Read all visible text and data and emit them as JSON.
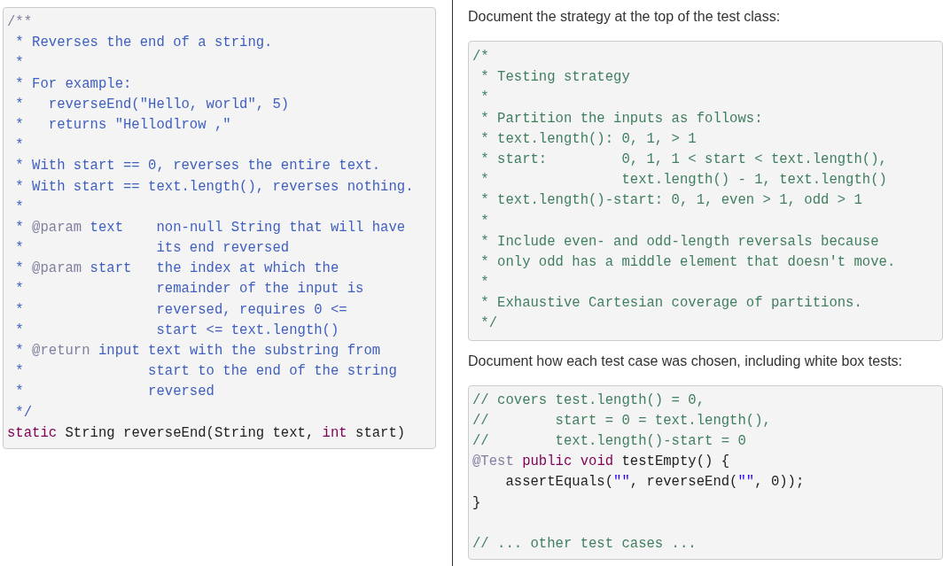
{
  "left_code": {
    "lines": [
      [
        {
          "kind": "tag",
          "text": "/**"
        }
      ],
      [
        {
          "kind": "doc",
          "text": " * Reverses the end of a string."
        }
      ],
      [
        {
          "kind": "doc",
          "text": " *"
        }
      ],
      [
        {
          "kind": "doc",
          "text": " * For example:"
        }
      ],
      [
        {
          "kind": "doc",
          "text": " *   reverseEnd(\"Hello, world\", 5)"
        }
      ],
      [
        {
          "kind": "doc",
          "text": " *   returns \"Hellodlrow ,\""
        }
      ],
      [
        {
          "kind": "doc",
          "text": " *"
        }
      ],
      [
        {
          "kind": "doc",
          "text": " * With start == 0, reverses the entire text."
        }
      ],
      [
        {
          "kind": "doc",
          "text": " * With start == text.length(), reverses nothing."
        }
      ],
      [
        {
          "kind": "doc",
          "text": " *"
        }
      ],
      [
        {
          "kind": "doc",
          "text": " * "
        },
        {
          "kind": "tag",
          "text": "@param"
        },
        {
          "kind": "doc",
          "text": " text    non-null String that will have"
        }
      ],
      [
        {
          "kind": "doc",
          "text": " *                its end reversed"
        }
      ],
      [
        {
          "kind": "doc",
          "text": " * "
        },
        {
          "kind": "tag",
          "text": "@param"
        },
        {
          "kind": "doc",
          "text": " start   the index at which the"
        }
      ],
      [
        {
          "kind": "doc",
          "text": " *                remainder of the input is"
        }
      ],
      [
        {
          "kind": "doc",
          "text": " *                reversed, requires 0 <="
        }
      ],
      [
        {
          "kind": "doc",
          "text": " *                start <= text.length()"
        }
      ],
      [
        {
          "kind": "doc",
          "text": " * "
        },
        {
          "kind": "tag",
          "text": "@return"
        },
        {
          "kind": "doc",
          "text": " input text with the substring from"
        }
      ],
      [
        {
          "kind": "doc",
          "text": " *               start to the end of the string"
        }
      ],
      [
        {
          "kind": "doc",
          "text": " *               reversed"
        }
      ],
      [
        {
          "kind": "doc",
          "text": " */"
        }
      ],
      [
        {
          "kind": "keyword",
          "text": "static"
        },
        {
          "kind": "plain",
          "text": " String reverseEnd(String text, "
        },
        {
          "kind": "keyword",
          "text": "int"
        },
        {
          "kind": "plain",
          "text": " start)"
        }
      ]
    ]
  },
  "strategy_heading": "Document the strategy at the top of the test class:",
  "strategy_code": {
    "lines": [
      [
        {
          "kind": "comment",
          "text": "/*"
        }
      ],
      [
        {
          "kind": "comment",
          "text": " * Testing strategy"
        }
      ],
      [
        {
          "kind": "comment",
          "text": " *"
        }
      ],
      [
        {
          "kind": "comment",
          "text": " * Partition the inputs as follows:"
        }
      ],
      [
        {
          "kind": "comment",
          "text": " * text.length(): 0, 1, > 1"
        }
      ],
      [
        {
          "kind": "comment",
          "text": " * start:         0, 1, 1 < start < text.length(),"
        }
      ],
      [
        {
          "kind": "comment",
          "text": " *                text.length() - 1, text.length()"
        }
      ],
      [
        {
          "kind": "comment",
          "text": " * text.length()-start: 0, 1, even > 1, odd > 1"
        }
      ],
      [
        {
          "kind": "comment",
          "text": " *"
        }
      ],
      [
        {
          "kind": "comment",
          "text": " * Include even- and odd-length reversals because"
        }
      ],
      [
        {
          "kind": "comment",
          "text": " * only odd has a middle element that doesn't move."
        }
      ],
      [
        {
          "kind": "comment",
          "text": " *"
        }
      ],
      [
        {
          "kind": "comment",
          "text": " * Exhaustive Cartesian coverage of partitions."
        }
      ],
      [
        {
          "kind": "comment",
          "text": " */"
        }
      ]
    ]
  },
  "cases_heading": "Document how each test case was chosen, including white box tests:",
  "cases_code": {
    "lines": [
      [
        {
          "kind": "comment",
          "text": "// covers test.length() = 0,"
        }
      ],
      [
        {
          "kind": "comment",
          "text": "//        start = 0 = text.length(),"
        }
      ],
      [
        {
          "kind": "comment",
          "text": "//        text.length()-start = 0"
        }
      ],
      [
        {
          "kind": "tag",
          "text": "@Test "
        },
        {
          "kind": "keyword",
          "text": "public void"
        },
        {
          "kind": "plain",
          "text": " testEmpty() {"
        }
      ],
      [
        {
          "kind": "plain",
          "text": "    assertEquals("
        },
        {
          "kind": "string",
          "text": "\"\""
        },
        {
          "kind": "plain",
          "text": ", reverseEnd("
        },
        {
          "kind": "string",
          "text": "\"\""
        },
        {
          "kind": "plain",
          "text": ", 0));"
        }
      ],
      [
        {
          "kind": "plain",
          "text": "}"
        }
      ],
      {
        "kind": "blank"
      },
      [
        {
          "kind": "comment",
          "text": "// ... other test cases ..."
        }
      ]
    ]
  }
}
